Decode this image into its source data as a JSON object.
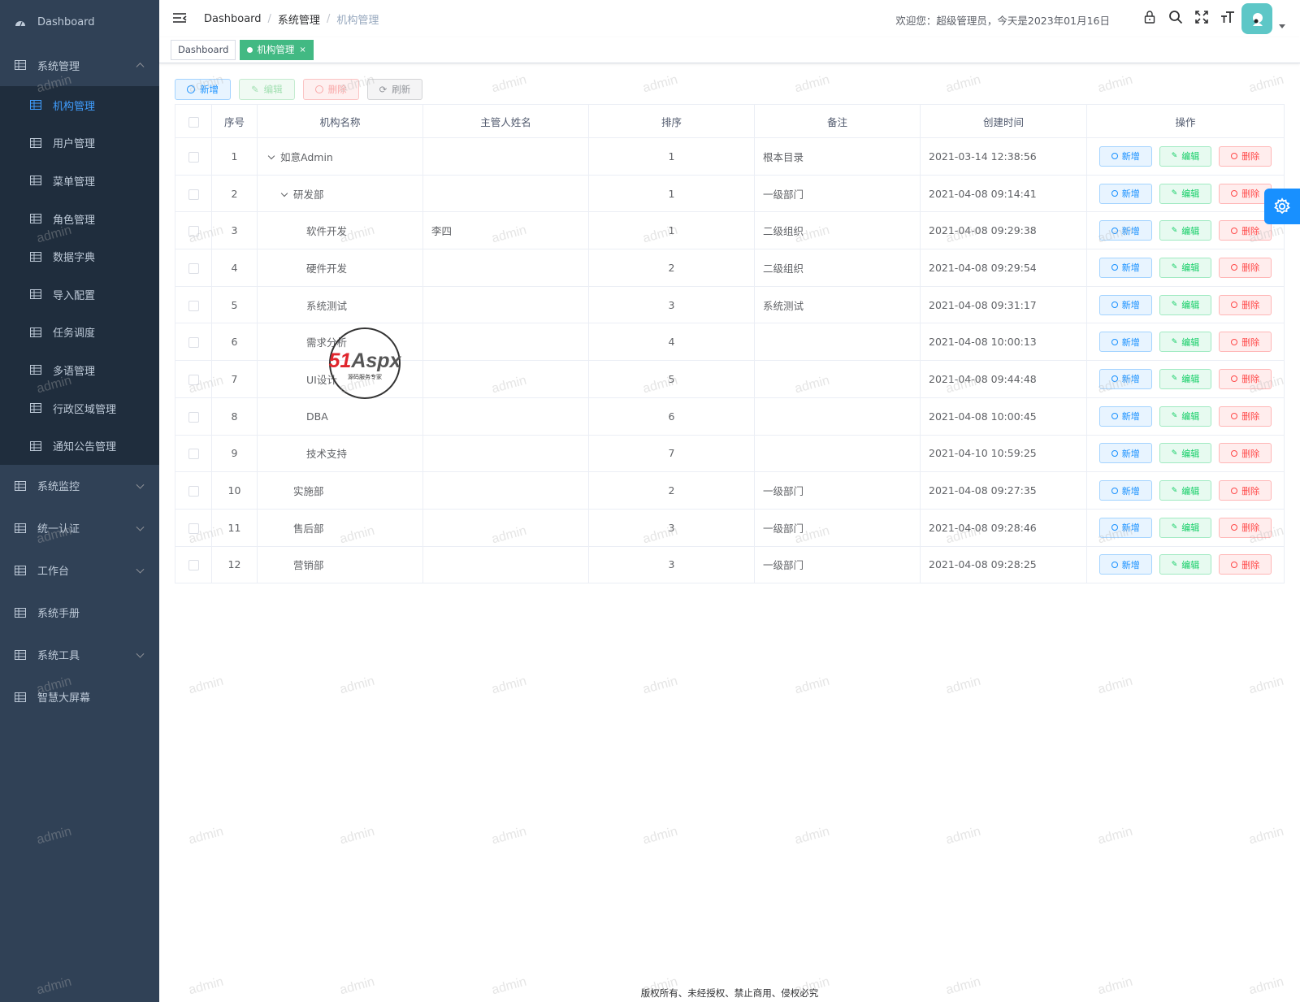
{
  "sidebar": {
    "dashboard": "Dashboard",
    "system_mgmt": "系统管理",
    "sub_items": [
      "机构管理",
      "用户管理",
      "菜单管理",
      "角色管理",
      "数据字典",
      "导入配置",
      "任务调度",
      "多语管理",
      "行政区域管理",
      "通知公告管理"
    ],
    "groups": [
      "系统监控",
      "统一认证",
      "工作台",
      "系统手册",
      "系统工具",
      "智慧大屏幕"
    ]
  },
  "navbar": {
    "breadcrumb": [
      "Dashboard",
      "系统管理",
      "机构管理"
    ],
    "welcome": "欢迎您：超级管理员，今天是2023年01月16日"
  },
  "tags": {
    "dashboard": "Dashboard",
    "active": "机构管理",
    "close": "×"
  },
  "toolbar": {
    "add": "新增",
    "edit": "编辑",
    "delete": "删除",
    "refresh": "刷新"
  },
  "table": {
    "headers": [
      "序号",
      "机构名称",
      "主管人姓名",
      "排序",
      "备注",
      "创建时间",
      "操作"
    ],
    "rows": [
      {
        "no": "1",
        "name": "如意Admin",
        "manager": "",
        "sort": "1",
        "remark": "根本目录",
        "time": "2021-03-14 12:38:56"
      },
      {
        "no": "2",
        "name": "研发部",
        "manager": "",
        "sort": "1",
        "remark": "一级部门",
        "time": "2021-04-08 09:14:41"
      },
      {
        "no": "3",
        "name": "软件开发",
        "manager": "李四",
        "sort": "1",
        "remark": "二级组织",
        "time": "2021-04-08 09:29:38"
      },
      {
        "no": "4",
        "name": "硬件开发",
        "manager": "",
        "sort": "2",
        "remark": "二级组织",
        "time": "2021-04-08 09:29:54"
      },
      {
        "no": "5",
        "name": "系统测试",
        "manager": "",
        "sort": "3",
        "remark": "系统测试",
        "time": "2021-04-08 09:31:17"
      },
      {
        "no": "6",
        "name": "需求分析",
        "manager": "",
        "sort": "4",
        "remark": "",
        "time": "2021-04-08 10:00:13"
      },
      {
        "no": "7",
        "name": "UI设计",
        "manager": "",
        "sort": "5",
        "remark": "",
        "time": "2021-04-08 09:44:48"
      },
      {
        "no": "8",
        "name": "DBA",
        "manager": "",
        "sort": "6",
        "remark": "",
        "time": "2021-04-08 10:00:45"
      },
      {
        "no": "9",
        "name": "技术支持",
        "manager": "",
        "sort": "7",
        "remark": "",
        "time": "2021-04-10 10:59:25"
      },
      {
        "no": "10",
        "name": "实施部",
        "manager": "",
        "sort": "2",
        "remark": "一级部门",
        "time": "2021-04-08 09:27:35"
      },
      {
        "no": "11",
        "name": "售后部",
        "manager": "",
        "sort": "3",
        "remark": "一级部门",
        "time": "2021-04-08 09:28:46"
      },
      {
        "no": "12",
        "name": "营销部",
        "manager": "",
        "sort": "3",
        "remark": "一级部门",
        "time": "2021-04-08 09:28:25"
      }
    ],
    "op_add": "新增",
    "op_edit": "编辑",
    "op_delete": "删除"
  },
  "watermark": "admin",
  "logo_text": "51Aspx",
  "logo_sub": "源码服务专家",
  "footer": "版权所有、未经授权、禁止商用、侵权必究",
  "colors": {
    "sidebar_bg": "#304156",
    "submenu_bg": "#1f2d3d",
    "accent": "#409eff",
    "tag_active": "#42b983",
    "settings_btn": "#1890ff"
  },
  "icons": {
    "dashboard": "dashboard-icon",
    "menu": "table-grid-icon",
    "hamburger": "hamburger-icon",
    "lock": "lock-icon",
    "search": "search-icon",
    "fullscreen": "fullscreen-icon",
    "font-size": "font-size-icon",
    "settings": "gear-icon"
  }
}
